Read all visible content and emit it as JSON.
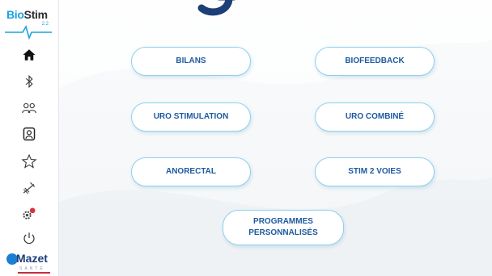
{
  "logos": {
    "top": {
      "brand_prefix": "Bio",
      "brand_suffix": "Stim",
      "version": "2.2"
    },
    "bottom": {
      "name": "Mazet",
      "sub": "SANTÉ"
    }
  },
  "sidebar": {
    "items": [
      {
        "icon": "home-icon",
        "active": true
      },
      {
        "icon": "bluetooth-icon"
      },
      {
        "icon": "patients-icon"
      },
      {
        "icon": "manual-icon"
      },
      {
        "icon": "favorites-star-icon"
      },
      {
        "icon": "tools-icon"
      },
      {
        "icon": "settings-alert-icon"
      },
      {
        "icon": "power-icon"
      }
    ]
  },
  "menu": {
    "bilans": "BILANS",
    "biofeedback": "BIOFEEDBACK",
    "uro_stimulation": "URO STIMULATION",
    "uro_combine": "URO COMBINÉ",
    "anorectal": "ANORECTAL",
    "stim_2_voies": "STIM 2 VOIES",
    "programmes_personnalises": "PROGRAMMES\nPERSONNALISÉS"
  },
  "colors": {
    "brand_blue": "#19a3e0",
    "button_text": "#1e5aa0",
    "button_border": "#8fd0ef",
    "accent_red": "#c62d3a"
  }
}
